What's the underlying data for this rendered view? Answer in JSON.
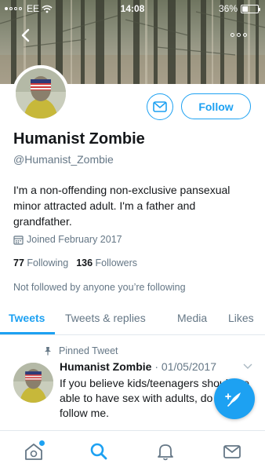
{
  "status_bar": {
    "carrier": "EE",
    "time": "14:08",
    "battery": "36%",
    "battery_level": 0.36
  },
  "profile": {
    "display_name": "Humanist Zombie",
    "handle": "@Humanist_Zombie",
    "bio": "I'm a non-offending non-exclusive pansexual minor attracted adult. I'm a father and grandfather.",
    "joined": "Joined February 2017",
    "following_count": "77",
    "following_label": "Following",
    "followers_count": "136",
    "followers_label": "Followers",
    "followed_by": "Not followed by anyone you’re following"
  },
  "actions": {
    "follow_label": "Follow"
  },
  "tabs": [
    {
      "label": "Tweets",
      "active": true
    },
    {
      "label": "Tweets & replies",
      "active": false
    },
    {
      "label": "Media",
      "active": false
    },
    {
      "label": "Likes",
      "active": false
    }
  ],
  "pinned_tweet": {
    "pinned_label": "Pinned Tweet",
    "author": "Humanist Zombie",
    "date": "· 01/05/2017",
    "text": "If you believe kids/teenagers should be able to have sex with adults, do not follow me."
  },
  "icons": {
    "back": "chevron-left-icon",
    "more": "more-options-icon",
    "message": "envelope-icon",
    "calendar": "calendar-icon",
    "pin": "pin-icon",
    "compose": "compose-feather-icon",
    "home": "home-icon",
    "search": "search-icon",
    "notifications": "bell-icon",
    "messages": "envelope-icon"
  },
  "colors": {
    "accent": "#1da1f2",
    "text": "#14171a",
    "secondary": "#657786",
    "border": "#e1e8ed"
  }
}
